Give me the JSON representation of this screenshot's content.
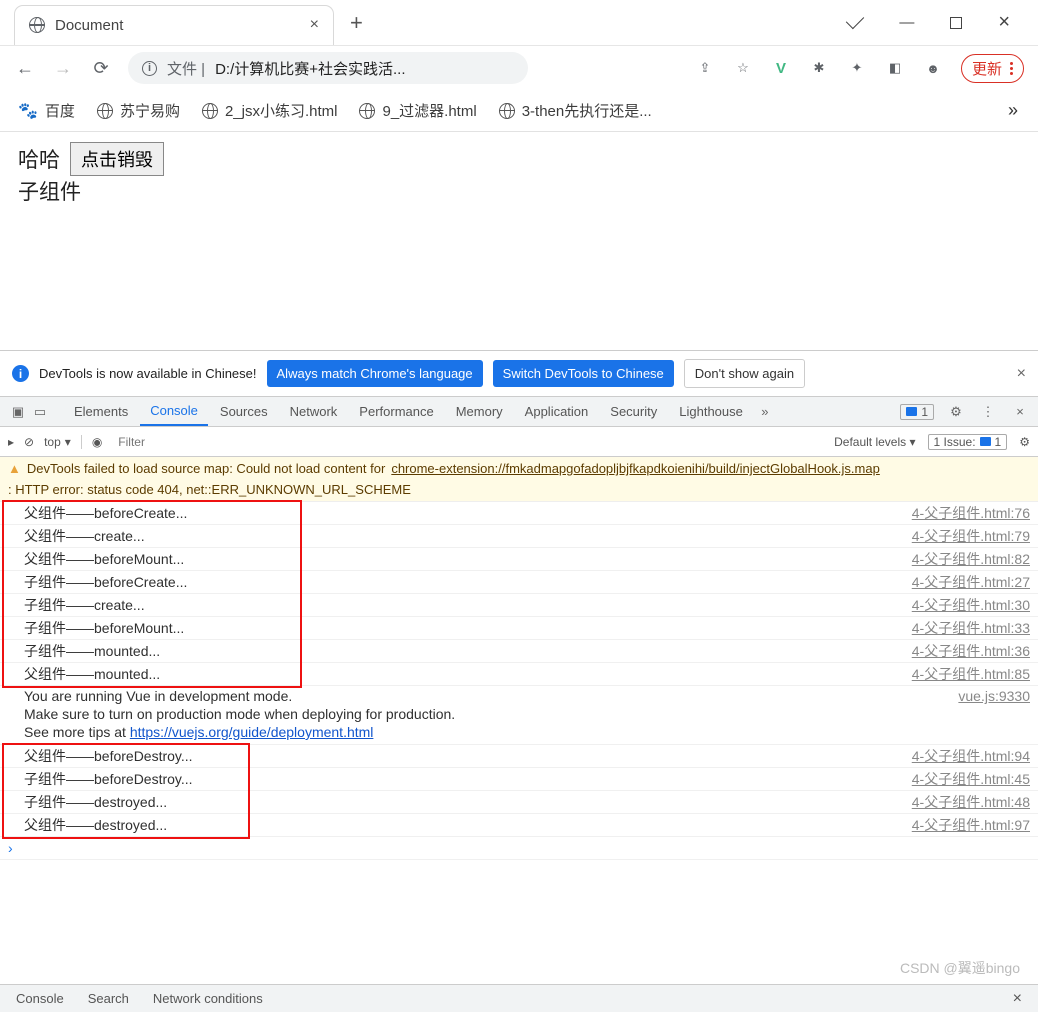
{
  "window": {
    "tab_title": "Document"
  },
  "address": {
    "prefix": "文件 |",
    "url": "D:/计算机比赛+社会实践活...",
    "update": "更新"
  },
  "bookmarks": [
    {
      "label": "百度",
      "icon": "paw"
    },
    {
      "label": "苏宁易购",
      "icon": "globe"
    },
    {
      "label": "2_jsx小练习.html",
      "icon": "globe"
    },
    {
      "label": "9_过滤器.html",
      "icon": "globe"
    },
    {
      "label": "3-then先执行还是...",
      "icon": "globe"
    }
  ],
  "page": {
    "text1": "哈哈",
    "button": "点击销毁",
    "text2": "子组件"
  },
  "banner": {
    "msg": "DevTools is now available in Chinese!",
    "btn1": "Always match Chrome's language",
    "btn2": "Switch DevTools to Chinese",
    "btn3": "Don't show again"
  },
  "devtools": {
    "tabs": [
      "Elements",
      "Console",
      "Sources",
      "Network",
      "Performance",
      "Memory",
      "Application",
      "Security",
      "Lighthouse"
    ],
    "active": "Console",
    "issues_badge": "1",
    "toolbar": {
      "context": "top",
      "filter_placeholder": "Filter",
      "levels": "Default levels",
      "issues": "1 Issue:"
    }
  },
  "warning": {
    "pre": "DevTools failed to load source map: Could not load content for ",
    "link": "chrome-extension://fmkadmapgofadopljbjfkapdkoienihi/build/injectGlobalHook.js.map",
    "post": ": HTTP error: status code 404, net::ERR_UNKNOWN_URL_SCHEME"
  },
  "logs1": [
    {
      "msg": "父组件——beforeCreate...",
      "src": "4-父子组件.html:76"
    },
    {
      "msg": "父组件——create...",
      "src": "4-父子组件.html:79"
    },
    {
      "msg": "父组件——beforeMount...",
      "src": "4-父子组件.html:82"
    },
    {
      "msg": "子组件——beforeCreate...",
      "src": "4-父子组件.html:27"
    },
    {
      "msg": "子组件——create...",
      "src": "4-父子组件.html:30"
    },
    {
      "msg": "子组件——beforeMount...",
      "src": "4-父子组件.html:33"
    },
    {
      "msg": "子组件——mounted...",
      "src": "4-父子组件.html:36"
    },
    {
      "msg": "父组件——mounted...",
      "src": "4-父子组件.html:85"
    }
  ],
  "vue_msg": {
    "l1": "You are running Vue in development mode.",
    "l2": "Make sure to turn on production mode when deploying for production.",
    "l3a": "See more tips at ",
    "l3link": "https://vuejs.org/guide/deployment.html",
    "src": "vue.js:9330"
  },
  "logs2": [
    {
      "msg": "父组件——beforeDestroy...",
      "src": "4-父子组件.html:94"
    },
    {
      "msg": "子组件——beforeDestroy...",
      "src": "4-父子组件.html:45"
    },
    {
      "msg": "子组件——destroyed...",
      "src": "4-父子组件.html:48"
    },
    {
      "msg": "父组件——destroyed...",
      "src": "4-父子组件.html:97"
    }
  ],
  "drawer": {
    "t1": "Console",
    "t2": "Search",
    "t3": "Network conditions"
  },
  "watermark": "CSDN @翼遥bingo"
}
